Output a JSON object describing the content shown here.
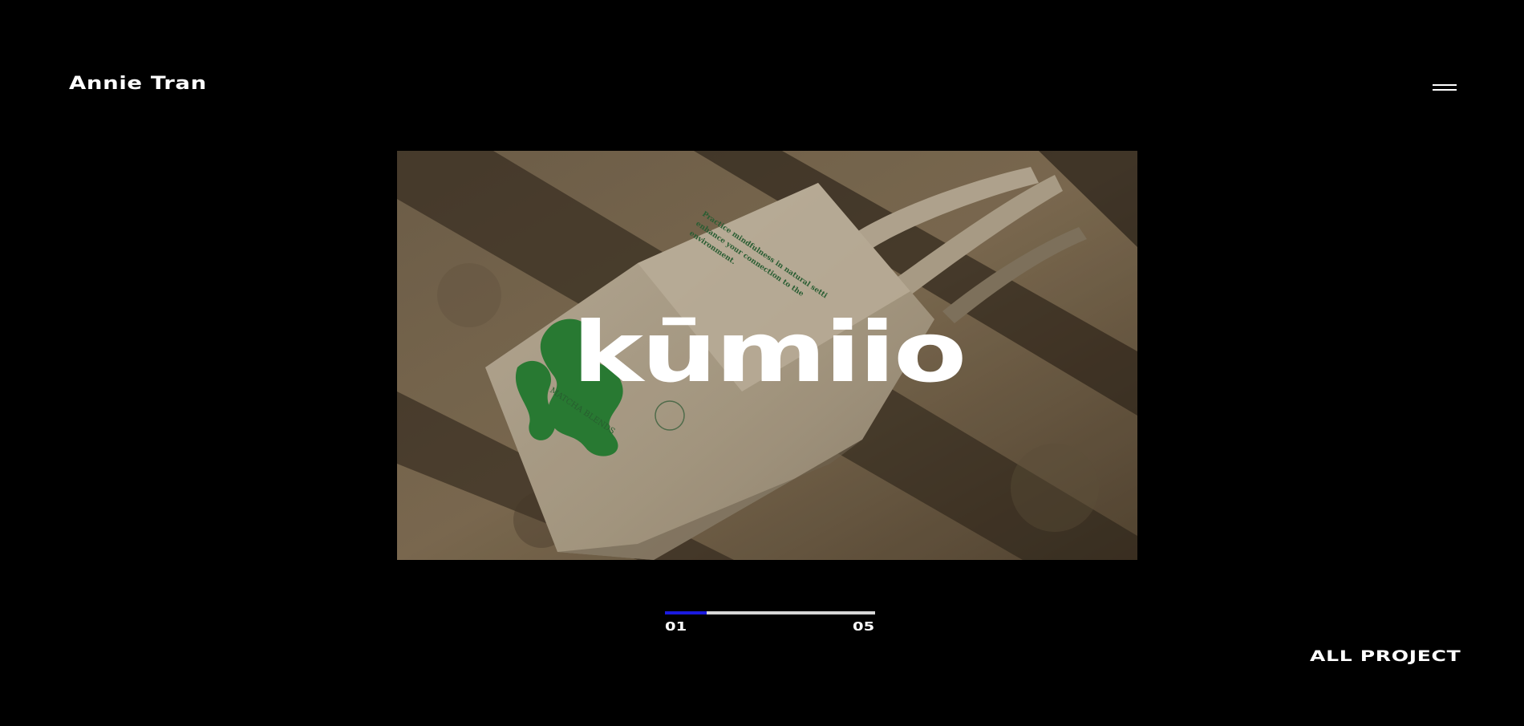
{
  "header": {
    "brand": "Annie Tran",
    "menu_icon": "hamburger-menu-icon"
  },
  "hero": {
    "title": "kūmiio",
    "image": "tote-bag-on-stone-steps-photo",
    "bag_print_text": "Practice mindfulness in natural setti... enhance your connection to the environment.",
    "bag_label": "MATCHA BLENDS"
  },
  "slider": {
    "current": "01",
    "total": "05",
    "progress": 0.2,
    "accent_color": "#1a1ae0"
  },
  "footer": {
    "all_projects": "ALL PROJECT"
  }
}
